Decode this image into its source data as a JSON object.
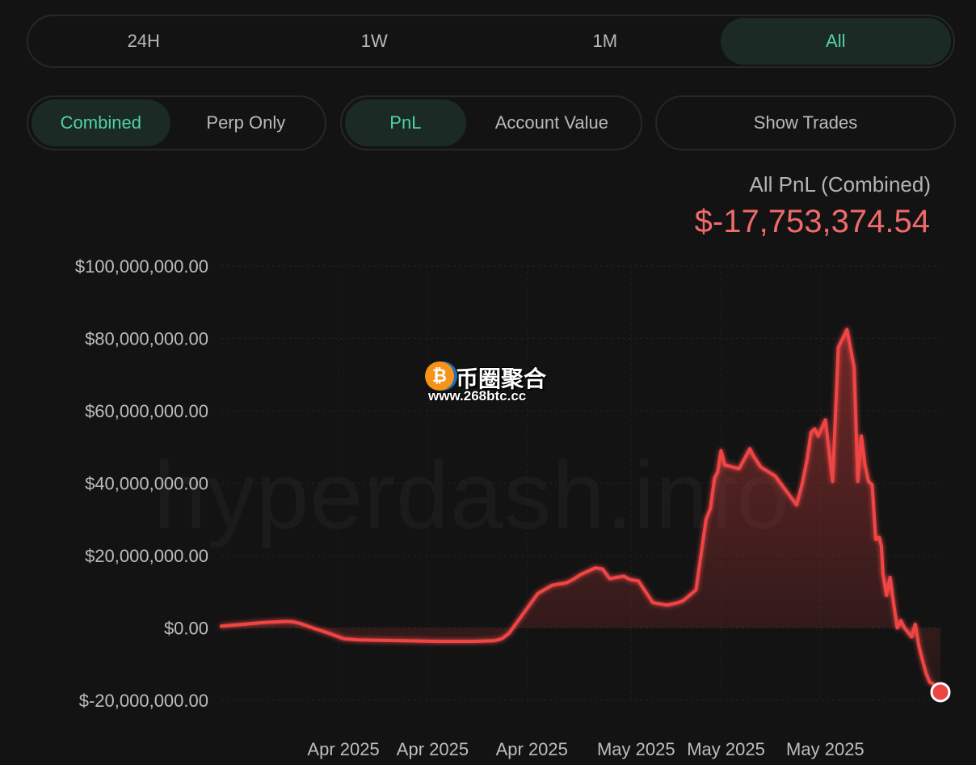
{
  "timeframe_tabs": [
    {
      "label": "24H",
      "active": false
    },
    {
      "label": "1W",
      "active": false
    },
    {
      "label": "1M",
      "active": false
    },
    {
      "label": "All",
      "active": true
    }
  ],
  "toggles": {
    "combined_label": "Combined",
    "perp_only_label": "Perp Only",
    "pnl_label": "PnL",
    "account_value_label": "Account Value",
    "show_trades_label": "Show Trades"
  },
  "summary": {
    "label": "All PnL (Combined)",
    "value": "$-17,753,374.54"
  },
  "watermark": {
    "background_text": "hyperdash.info",
    "logo_title": "币圈聚合",
    "logo_url": "www.268btc.cc"
  },
  "colors": {
    "accent_green": "#4fd3a3",
    "line_red": "#ef4444",
    "value_red": "#f06a6a"
  },
  "chart_data": {
    "type": "area",
    "title": "",
    "xlabel": "",
    "ylabel": "",
    "ylim": [
      -20000000,
      100000000
    ],
    "y_ticks": [
      -20000000,
      0,
      20000000,
      40000000,
      60000000,
      80000000,
      100000000
    ],
    "y_tick_labels": [
      "$-20,000,000.00",
      "$0.00",
      "$20,000,000.00",
      "$40,000,000.00",
      "$60,000,000.00",
      "$80,000,000.00",
      "$100,000,000.00"
    ],
    "x_tick_labels": [
      "Apr 2025",
      "Apr 2025",
      "Apr 2025",
      "May 2025",
      "May 2025",
      "May 2025"
    ],
    "x_tick_positions": [
      0.163,
      0.287,
      0.425,
      0.57,
      0.695,
      0.833
    ],
    "grid": true,
    "series": [
      {
        "x": [
          0,
          0.03,
          0.06,
          0.09,
          0.1,
          0.11,
          0.13,
          0.15,
          0.17,
          0.19,
          0.25,
          0.3,
          0.35,
          0.38,
          0.39,
          0.4,
          0.42,
          0.44,
          0.46,
          0.48,
          0.49,
          0.5,
          0.52,
          0.53,
          0.54,
          0.55,
          0.56,
          0.565,
          0.57,
          0.58,
          0.6,
          0.62,
          0.635,
          0.642,
          0.648,
          0.66,
          0.674,
          0.68,
          0.686,
          0.69,
          0.695,
          0.7,
          0.72,
          0.735,
          0.74,
          0.75,
          0.77,
          0.8,
          0.808,
          0.815,
          0.82,
          0.825,
          0.83,
          0.84,
          0.85,
          0.858,
          0.87,
          0.88,
          0.885,
          0.89,
          0.895,
          0.9,
          0.905,
          0.91,
          0.915,
          0.918,
          0.92,
          0.925,
          0.93,
          0.935,
          0.94,
          0.945,
          0.95,
          0.96,
          0.965,
          0.97,
          0.975,
          0.98,
          0.985,
          0.99,
          0.995,
          1.0
        ],
        "y": [
          500000,
          1000000,
          1500000,
          1800000,
          1700000,
          1200000,
          -200000,
          -1500000,
          -3000000,
          -3300000,
          -3500000,
          -3700000,
          -3700000,
          -3500000,
          -3000000,
          -1500000,
          4000000,
          9500000,
          11800000,
          12500000,
          13500000,
          14800000,
          16600000,
          16300000,
          13600000,
          14000000,
          14300000,
          13700000,
          13300000,
          13000000,
          7000000,
          6300000,
          7000000,
          7500000,
          8500000,
          10500000,
          30000000,
          33000000,
          41500000,
          43000000,
          49000000,
          45000000,
          44000000,
          49500000,
          47500000,
          44500000,
          42000000,
          34000000,
          40000000,
          47000000,
          54000000,
          55000000,
          53000000,
          57500000,
          40500000,
          77500000,
          82500000,
          72000000,
          40500000,
          53000000,
          45000000,
          40500000,
          39500000,
          24500000,
          25000000,
          22500000,
          15000000,
          9000000,
          14000000,
          6500000,
          0,
          2000000,
          0,
          -2500000,
          1000000,
          -5000000,
          -9000000,
          -12500000,
          -15000000,
          -15500000,
          -17000000,
          -17753374.54
        ]
      }
    ],
    "last_value": -17753374.54
  }
}
